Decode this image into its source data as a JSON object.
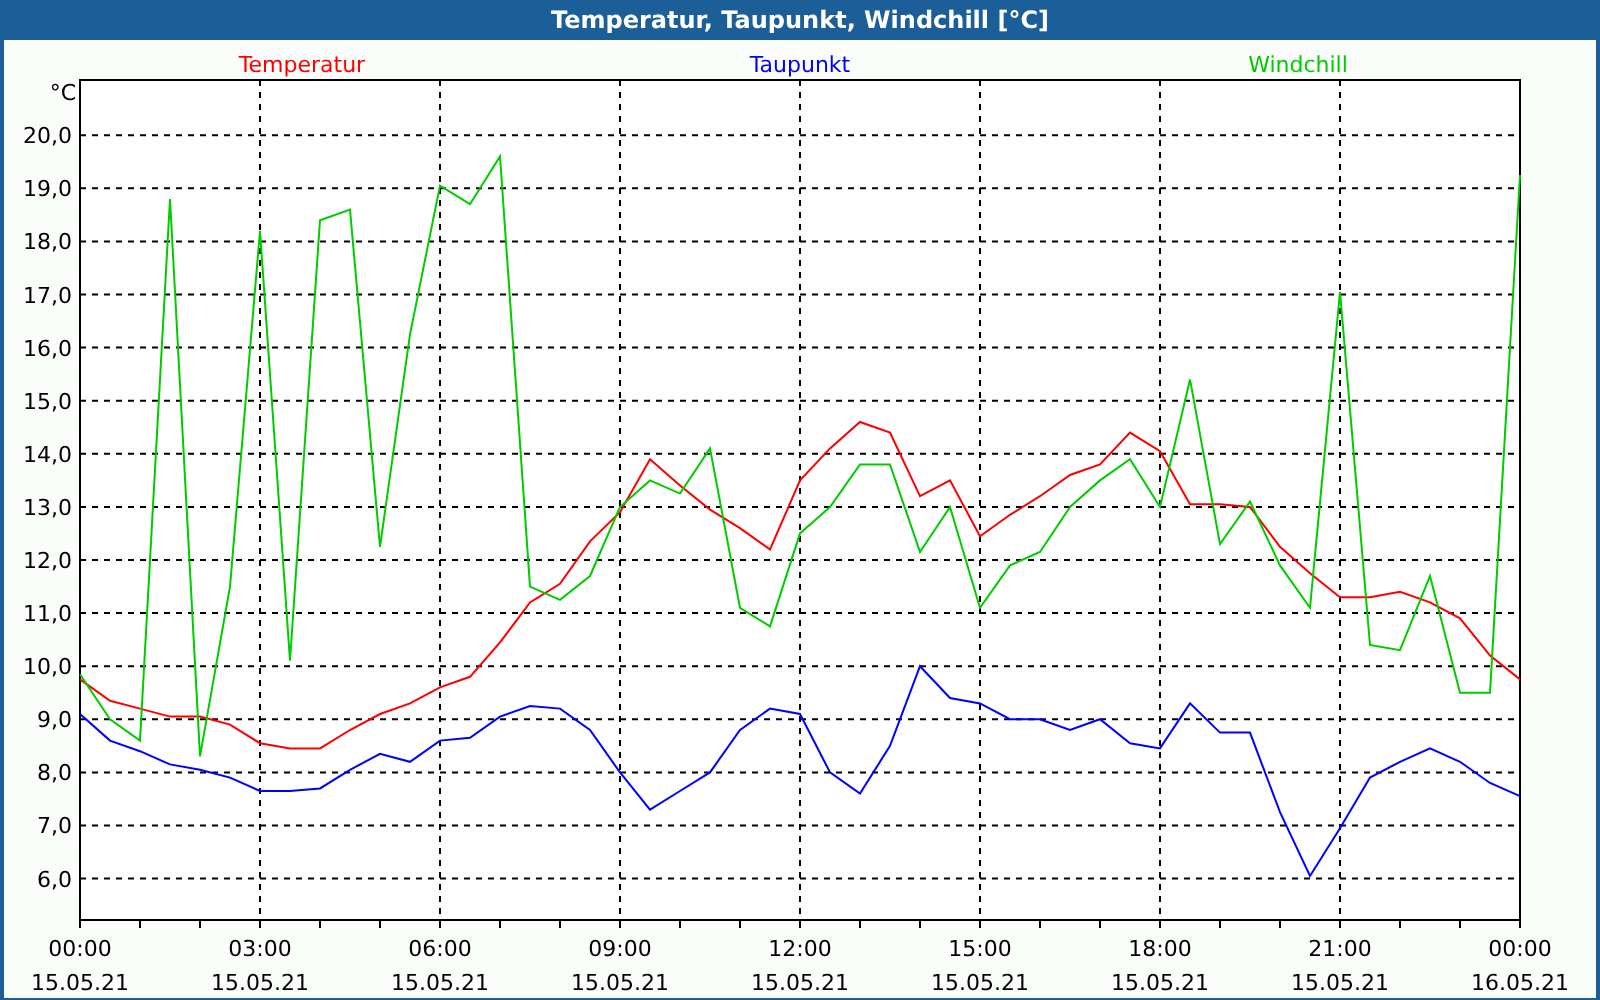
{
  "window": {
    "title": "Temperatur, Taupunkt, Windchill [°C]"
  },
  "chart": {
    "chart_data": {
      "type": "line",
      "ylabel": "°C",
      "ylim": [
        5.22,
        21.04
      ],
      "grid": true,
      "categories": [
        "00:00\n15.05.21",
        null,
        null,
        null,
        null,
        null,
        "03:00\n15.05.21",
        null,
        null,
        null,
        null,
        null,
        "06:00\n15.05.21",
        null,
        null,
        null,
        null,
        null,
        "09:00\n15.05.21",
        null,
        null,
        null,
        null,
        null,
        "12:00\n15.05.21",
        null,
        null,
        null,
        null,
        null,
        "15:00\n15.05.21",
        null,
        null,
        null,
        null,
        null,
        "18:00\n15.05.21",
        null,
        null,
        null,
        null,
        null,
        "21:00\n15.05.21",
        null,
        null,
        null,
        null,
        null,
        "00:00\n16.05.21"
      ],
      "series": [
        {
          "name": "Temperatur",
          "color": "#ff0000",
          "values": [
            9.75,
            9.35,
            9.2,
            9.05,
            9.05,
            8.9,
            8.55,
            8.45,
            8.45,
            8.8,
            9.1,
            9.3,
            9.6,
            9.8,
            10.45,
            11.2,
            11.55,
            12.35,
            12.9,
            13.9,
            13.4,
            12.95,
            12.6,
            12.2,
            13.5,
            14.1,
            14.6,
            14.4,
            13.2,
            13.5,
            12.45,
            12.85,
            13.2,
            13.6,
            13.8,
            14.4,
            14.05,
            13.05,
            13.05,
            13.0,
            12.25,
            11.75,
            11.3,
            11.3,
            11.4,
            11.2,
            10.9,
            10.2,
            9.75
          ]
        },
        {
          "name": "Taupunkt",
          "color": "#0000ff",
          "values": [
            9.1,
            8.6,
            8.4,
            8.15,
            8.05,
            7.9,
            7.65,
            7.65,
            7.7,
            8.05,
            8.35,
            8.2,
            8.6,
            8.65,
            9.05,
            9.25,
            9.2,
            8.8,
            8.0,
            7.3,
            7.65,
            8.0,
            8.8,
            9.2,
            9.1,
            8.0,
            7.6,
            8.5,
            10.0,
            9.4,
            9.3,
            9.0,
            9.0,
            8.8,
            9.0,
            8.55,
            8.45,
            9.3,
            8.75,
            8.75,
            7.25,
            6.05,
            6.95,
            7.9,
            8.2,
            8.45,
            8.2,
            7.8,
            7.55
          ]
        },
        {
          "name": "Windchill",
          "color": "#00cc00",
          "values": [
            9.85,
            9.0,
            8.6,
            18.8,
            8.3,
            11.5,
            18.2,
            10.1,
            18.4,
            18.6,
            12.25,
            16.25,
            19.05,
            18.7,
            19.6,
            11.5,
            11.25,
            11.7,
            13.0,
            13.5,
            13.25,
            14.1,
            11.1,
            10.75,
            12.5,
            13.0,
            13.8,
            13.8,
            12.15,
            13.0,
            11.1,
            11.9,
            12.15,
            13.0,
            13.5,
            13.9,
            13.0,
            15.4,
            12.3,
            13.1,
            11.9,
            11.1,
            17.05,
            10.4,
            10.3,
            11.7,
            9.5,
            9.5,
            19.25
          ]
        }
      ],
      "yticks": [
        {
          "value": 6,
          "label": "6,0"
        },
        {
          "value": 7,
          "label": "7,0"
        },
        {
          "value": 8,
          "label": "8,0"
        },
        {
          "value": 9,
          "label": "9,0"
        },
        {
          "value": 10,
          "label": "10,0"
        },
        {
          "value": 11,
          "label": "11,0"
        },
        {
          "value": 12,
          "label": "12,0"
        },
        {
          "value": 13,
          "label": "13,0"
        },
        {
          "value": 14,
          "label": "14,0"
        },
        {
          "value": 15,
          "label": "15,0"
        },
        {
          "value": 16,
          "label": "16,0"
        },
        {
          "value": 17,
          "label": "17,0"
        },
        {
          "value": 18,
          "label": "18,0"
        },
        {
          "value": 19,
          "label": "19,0"
        },
        {
          "value": 20,
          "label": "20,0"
        }
      ]
    }
  }
}
